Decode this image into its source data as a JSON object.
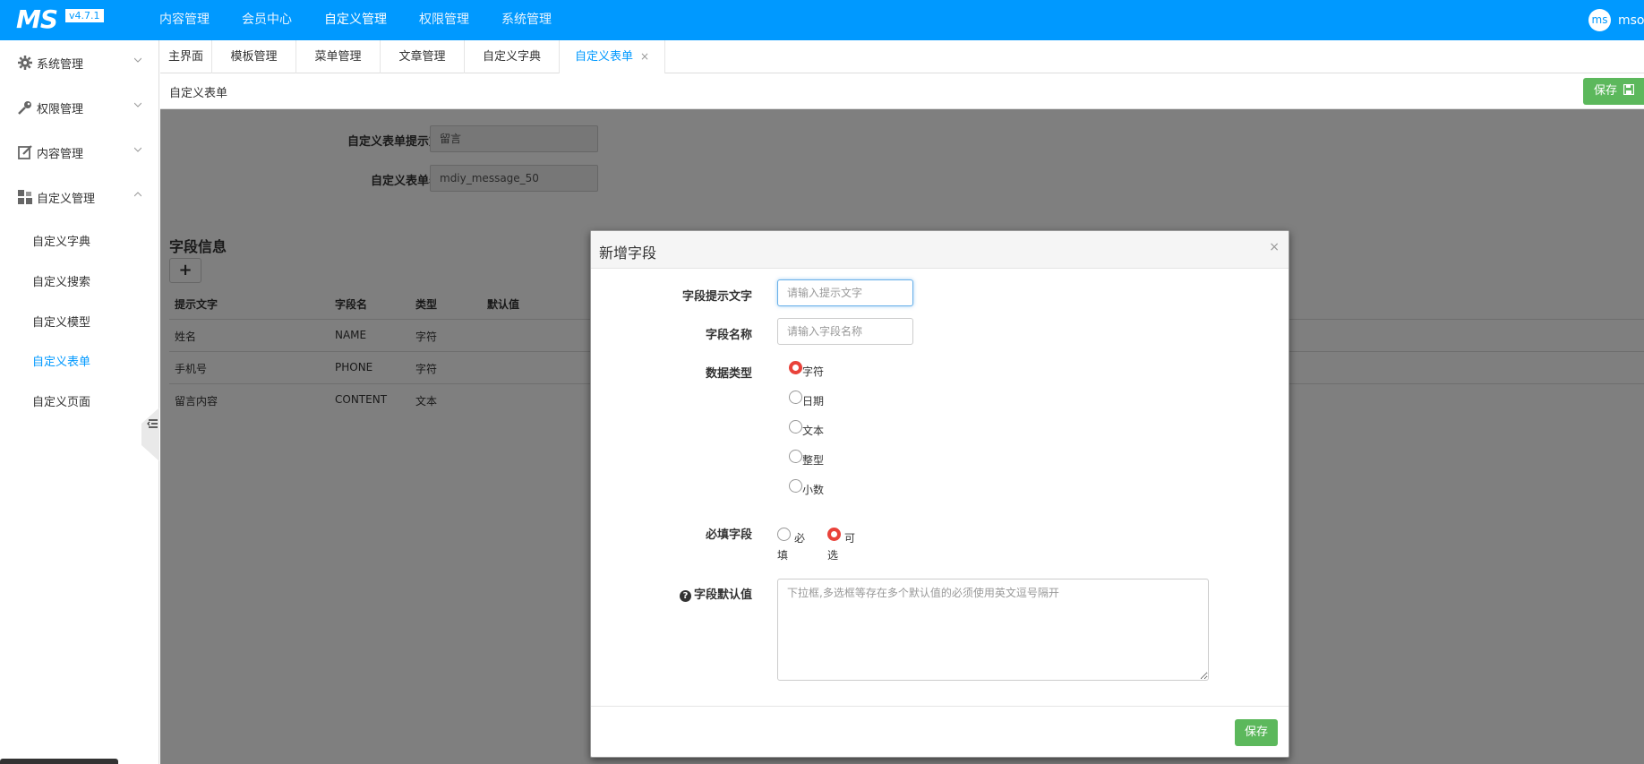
{
  "header": {
    "logo": "MS",
    "version": "v4.7.1",
    "nav": [
      {
        "label": "内容管理"
      },
      {
        "label": "会员中心"
      },
      {
        "label": "自定义管理"
      },
      {
        "label": "权限管理"
      },
      {
        "label": "系统管理"
      }
    ],
    "active_nav_index": 2,
    "avatar": "ms",
    "username": "msop"
  },
  "sidebar": {
    "groups": [
      {
        "label": "系统管理",
        "icon": "gear-icon",
        "expanded": false
      },
      {
        "label": "权限管理",
        "icon": "key-icon",
        "expanded": false
      },
      {
        "label": "内容管理",
        "icon": "edit-icon",
        "expanded": false
      },
      {
        "label": "自定义管理",
        "icon": "modules-icon",
        "expanded": true
      }
    ],
    "sub_items": [
      {
        "label": "自定义字典"
      },
      {
        "label": "自定义搜索"
      },
      {
        "label": "自定义模型"
      },
      {
        "label": "自定义表单",
        "active": true
      },
      {
        "label": "自定义页面"
      }
    ]
  },
  "tabs": [
    {
      "label": "主界面"
    },
    {
      "label": "模板管理"
    },
    {
      "label": "菜单管理"
    },
    {
      "label": "文章管理"
    },
    {
      "label": "自定义字典"
    },
    {
      "label": "自定义表单",
      "active": true,
      "close": "×"
    }
  ],
  "page": {
    "title": "自定义表单",
    "save_label": "保存",
    "form": {
      "hint_label": "自定义表单提示文字",
      "hint_value": "留言",
      "table_label": "自定义表单表名",
      "table_value": "mdiy_message_50"
    },
    "section_title": "字段信息",
    "add_button": "+",
    "table": {
      "headers": [
        "提示文字",
        "字段名",
        "类型",
        "默认值"
      ],
      "rows": [
        [
          "姓名",
          "NAME",
          "字符",
          ""
        ],
        [
          "手机号",
          "PHONE",
          "字符",
          ""
        ],
        [
          "留言内容",
          "CONTENT",
          "文本",
          ""
        ]
      ]
    }
  },
  "modal": {
    "title": "新增字段",
    "close": "×",
    "field_hint_label": "字段提示文字",
    "field_hint_placeholder": "请输入提示文字",
    "field_name_label": "字段名称",
    "field_name_placeholder": "请输入字段名称",
    "data_type_label": "数据类型",
    "data_types": [
      "字符",
      "日期",
      "文本",
      "整型",
      "小数"
    ],
    "data_type_selected": 0,
    "required_label": "必填字段",
    "required_options": [
      {
        "line1": "必",
        "line2": "填"
      },
      {
        "line1": "可",
        "line2": "选"
      }
    ],
    "required_selected": 1,
    "default_label": "字段默认值",
    "default_placeholder": "下拉框,多选框等存在多个默认值的必须使用英文逗号隔开",
    "help_icon": "?",
    "save_label": "保存"
  },
  "colors": {
    "brand": "#0099ff",
    "save_green": "#5cb85c",
    "radio_red": "#e9423a"
  }
}
